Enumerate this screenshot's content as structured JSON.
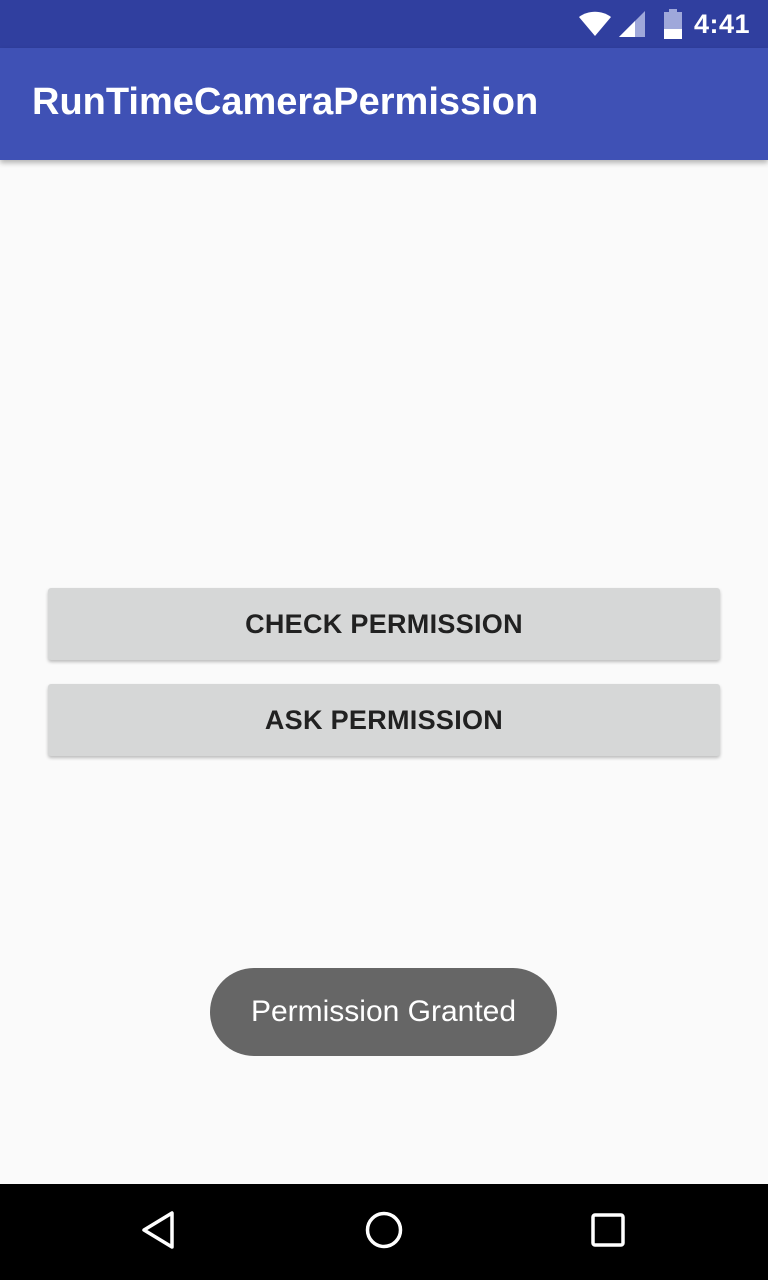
{
  "status_bar": {
    "time": "4:41",
    "icons": [
      "wifi-icon",
      "signal-icon",
      "battery-icon"
    ]
  },
  "app_bar": {
    "title": "RunTimeCameraPermission"
  },
  "main": {
    "check_button_label": "CHECK PERMISSION",
    "ask_button_label": "ASK PERMISSION"
  },
  "toast": {
    "message": "Permission Granted"
  },
  "nav_bar": {
    "icons": [
      "back-icon",
      "home-icon",
      "recents-icon"
    ]
  },
  "colors": {
    "status_bar": "#303f9f",
    "app_bar": "#3f51b5",
    "background": "#fafafa",
    "button": "#d6d7d7",
    "toast": "#666666",
    "nav_bar": "#000000"
  }
}
